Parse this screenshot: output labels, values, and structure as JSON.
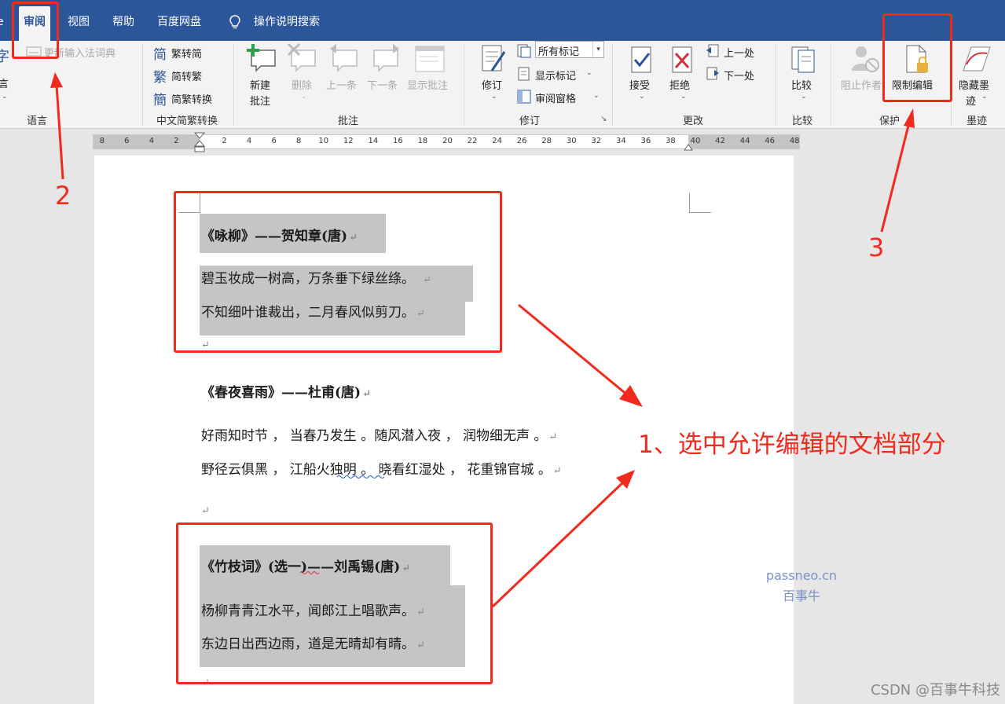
{
  "menu": {
    "tabs": [
      "审阅",
      "视图",
      "帮助",
      "百度网盘",
      "操作说明搜索"
    ]
  },
  "ribbon": {
    "language": {
      "item1": "更新输入法词典",
      "item2": "言",
      "label": "语言"
    },
    "chinese": {
      "item1": "繁转简",
      "item2": "简转繁",
      "item3": "简繁转换",
      "label": "中文简繁转换"
    },
    "comments": {
      "new_line1": "新建",
      "new_line2": "批注",
      "delete": "删除",
      "prev": "上一条",
      "next": "下一条",
      "show": "显示批注",
      "label": "批注"
    },
    "tracking": {
      "track_changes": "修订",
      "markup_select": "所有标记",
      "show_markup": "显示标记",
      "review_pane": "审阅窗格",
      "label": "修订"
    },
    "changes": {
      "accept": "接受",
      "reject": "拒绝",
      "prev": "上一处",
      "next": "下一处",
      "label": "更改"
    },
    "compare": {
      "compare": "比较",
      "label": "比较"
    },
    "protect": {
      "block_authors": "阻止作者",
      "restrict_editing": "限制编辑",
      "label": "保护"
    },
    "ink": {
      "hide_line1": "隐藏墨",
      "hide_line2": "迹",
      "label": "墨迹"
    }
  },
  "ruler": {
    "left_numbers": [
      "8",
      "6",
      "4",
      "2"
    ],
    "right_numbers": [
      "2",
      "4",
      "6",
      "8",
      "10",
      "12",
      "14",
      "16",
      "18",
      "20",
      "22",
      "24",
      "26",
      "28",
      "30",
      "32",
      "34",
      "36",
      "38",
      "40",
      "42",
      "44",
      "46",
      "48"
    ]
  },
  "document": {
    "poem1": {
      "title": "《咏柳》——贺知章(唐)",
      "line1": "碧玉妆成一树高，万条垂下绿丝绦。",
      "line2": "不知细叶谁裁出，二月春风似剪刀。"
    },
    "poem2": {
      "title": "《春夜喜雨》——杜甫(唐)",
      "line1": "好雨知时节 ， 当春乃发生 。随风潜入夜 ， 润物细无声 。",
      "line2": "野径云俱黑 ， 江船火独明 。 晓看红湿处 ， 花重锦官城 。"
    },
    "poem3": {
      "title": "《竹枝词》(选一)——刘禹锡(唐)",
      "line1": "杨柳青青江水平，闻郎江上唱歌声。",
      "line2": "东边日出西边雨，道是无晴却有晴。"
    },
    "paragraph_mark": "↵"
  },
  "annotations": {
    "step1": "1、选中允许编辑的文档部分",
    "step2": "2",
    "step3": "3",
    "color": "#f02a1d"
  },
  "watermark": {
    "line1": "passneo.cn",
    "line2": "百事牛"
  },
  "footer": {
    "credit": "CSDN @百事牛科技"
  },
  "colors": {
    "menubar": "#2b579a",
    "ribbon": "#f3f3f3",
    "highlight": "#c5c5c5",
    "red": "#f02a1d"
  }
}
